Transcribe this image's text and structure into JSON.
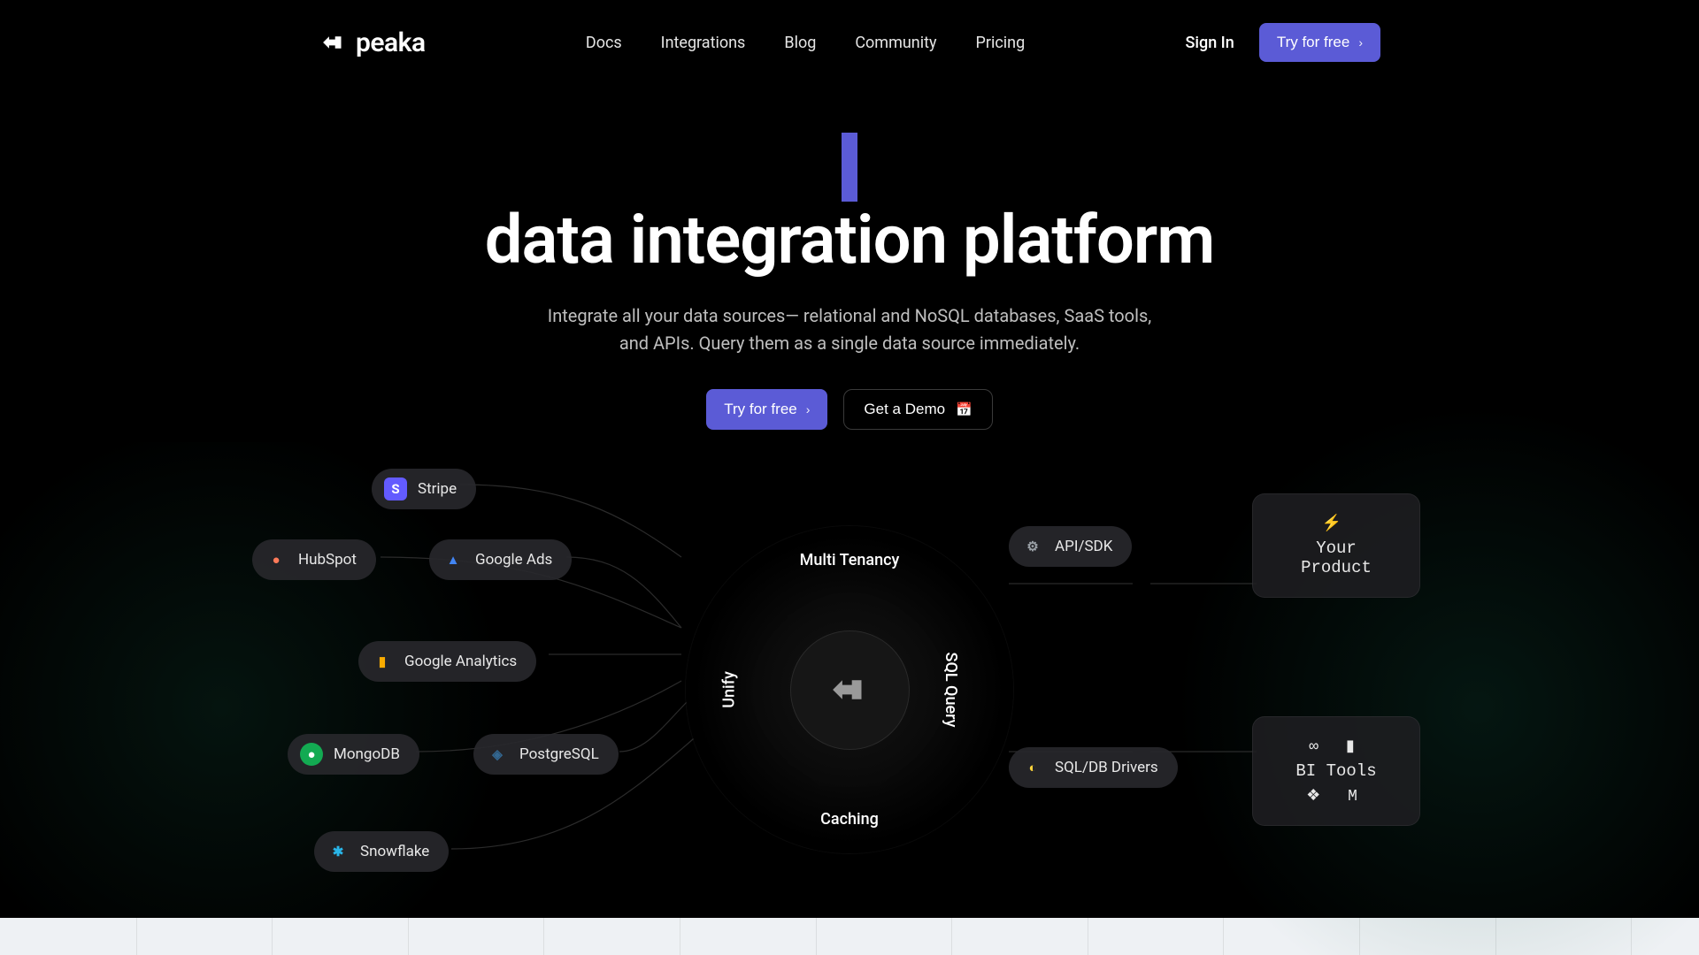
{
  "brand": "peaka",
  "nav": {
    "items": [
      "Docs",
      "Integrations",
      "Blog",
      "Community",
      "Pricing"
    ],
    "signin": "Sign In",
    "cta": "Try for free"
  },
  "hero": {
    "line1_cursor_prefix": "",
    "line2": "data integration platform",
    "body": "Integrate all your data sources— relational and NoSQL databases, SaaS tools, and APIs. Query them as a single data source immediately.",
    "cta_primary": "Try for free",
    "cta_secondary": "Get a Demo"
  },
  "diagram": {
    "left_pills": [
      {
        "label": "Stripe",
        "bg": "#635bff",
        "fg": "#fff",
        "glyph": "S"
      },
      {
        "label": "HubSpot",
        "bg": "transparent",
        "fg": "#ff7a59",
        "glyph": "●"
      },
      {
        "label": "Google Ads",
        "bg": "transparent",
        "fg": "#4285f4",
        "glyph": "▲"
      },
      {
        "label": "Google Analytics",
        "bg": "transparent",
        "fg": "#f9ab00",
        "glyph": "▮"
      },
      {
        "label": "MongoDB",
        "bg": "#13aa52",
        "fg": "#fff",
        "glyph": "●"
      },
      {
        "label": "PostgreSQL",
        "bg": "transparent",
        "fg": "#336791",
        "glyph": "◈"
      },
      {
        "label": "Snowflake",
        "bg": "transparent",
        "fg": "#29b5e8",
        "glyph": "✱"
      }
    ],
    "ring": {
      "top": "Multi Tenancy",
      "bottom": "Caching",
      "left": "Unify",
      "right": "SQL Query"
    },
    "right_pills": [
      {
        "label": "API/SDK",
        "icon_fg": "#9aa0a6",
        "glyph": "⚙"
      },
      {
        "label": "SQL/DB Drivers",
        "icon_fg": "#ffd43b",
        "glyph": "◐"
      }
    ],
    "panels": {
      "product": {
        "emoji": "⚡",
        "label": "Your Product"
      },
      "bi": {
        "row1": "∞  ▮",
        "label": "BI Tools",
        "row2": "❖  M"
      }
    }
  }
}
